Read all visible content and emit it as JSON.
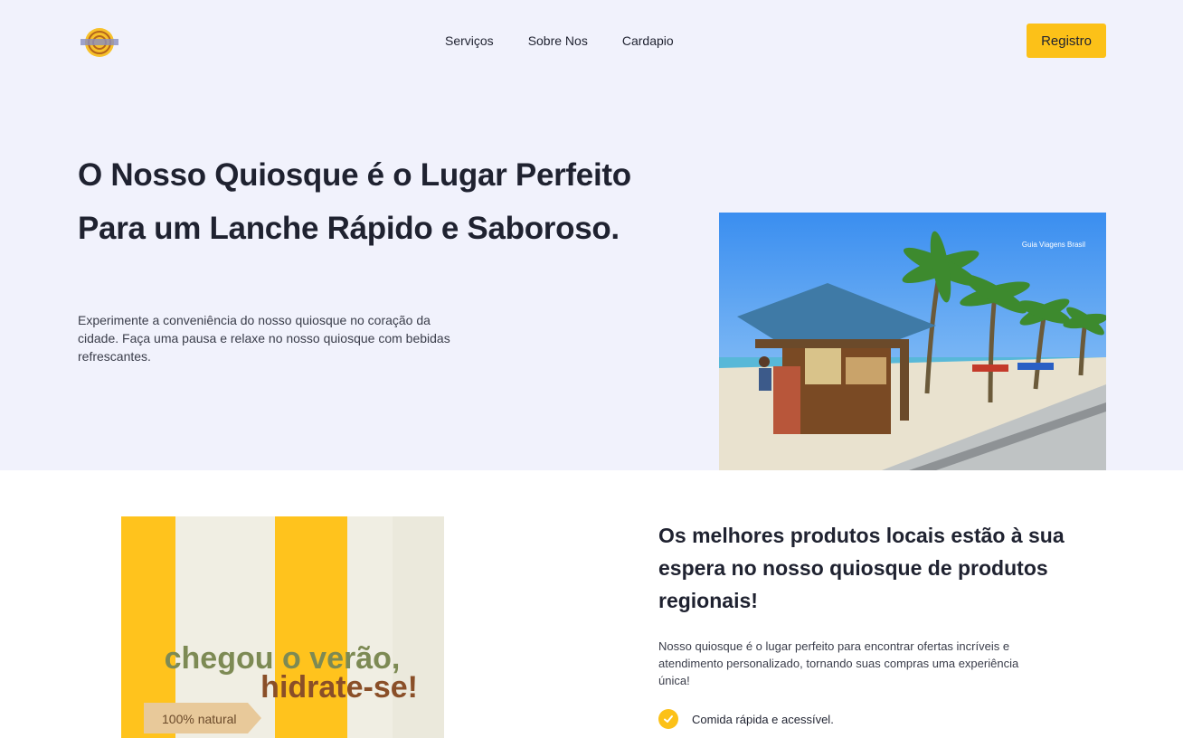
{
  "header": {
    "nav": [
      "Serviços",
      "Sobre Nos",
      "Cardapio"
    ],
    "register_label": "Registro"
  },
  "hero": {
    "title": "O Nosso Quiosque é o Lugar Perfeito Para um Lanche Rápido e Saboroso.",
    "text": "Experimente a conveniência do nosso quiosque no coração da cidade. Faça uma pausa e relaxe no nosso quiosque com bebidas refrescantes.",
    "image_watermark": "Guia Viagens Brasil"
  },
  "promo": {
    "line1": "chegou o verão,",
    "line2": "hidrate-se!",
    "tag": "100% natural"
  },
  "section": {
    "title": "Os melhores produtos locais estão à sua espera no nosso quiosque de produtos regionais!",
    "text": "Nosso quiosque é o lugar perfeito para encontrar ofertas incríveis e atendimento personalizado, tornando suas compras uma experiência única!",
    "features": [
      "Comida rápida e acessível."
    ]
  },
  "colors": {
    "accent": "#fcc118",
    "hero_bg": "#f1f2fc",
    "text": "#1f2230"
  }
}
